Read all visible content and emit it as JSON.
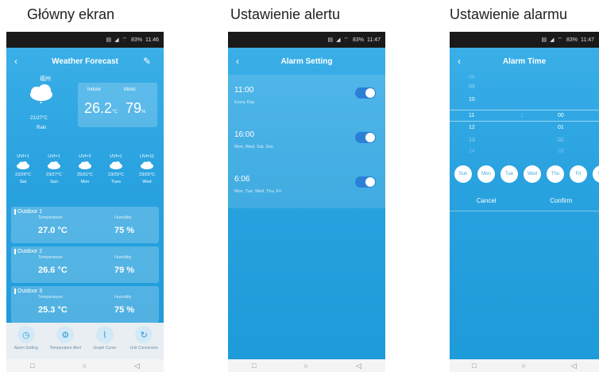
{
  "headings": {
    "main": "Główny ekran",
    "alert": "Ustawienie alertu",
    "alarm": "Ustawienie alarmu"
  },
  "status": {
    "p1": {
      "battery": "83%",
      "time": "11:46"
    },
    "p2": {
      "battery": "83%",
      "time": "11:47"
    },
    "p3": {
      "battery": "83%",
      "time": "11:47"
    }
  },
  "weather": {
    "title": "Weather Forecast",
    "city": "福州",
    "temp_range": "21/27°C",
    "description": "Rain",
    "indoor_label": "Indoor",
    "moist_label": "Moist",
    "indoor_temp": "26.2",
    "temp_unit": "°C",
    "indoor_humidity": "79",
    "hum_unit": "%",
    "forecast": [
      {
        "uvi": "UVI=1",
        "temp": "22/26°C",
        "day": "Sat",
        "icon": "rain-cloud-icon"
      },
      {
        "uvi": "UVI=1",
        "temp": "23/27°C",
        "day": "Sun",
        "icon": "cloud-icon"
      },
      {
        "uvi": "UVI=2",
        "temp": "25/31°C",
        "day": "Mon",
        "icon": "cloud-icon"
      },
      {
        "uvi": "UVI=1",
        "temp": "23/25°C",
        "day": "Tues",
        "icon": "rain-cloud-icon"
      },
      {
        "uvi": "UVI=11",
        "temp": "23/25°C",
        "day": "Wed",
        "icon": "cloud-icon"
      }
    ],
    "outdoor": [
      {
        "name": "Outdoor 1",
        "temp_label": "Temperature",
        "hum_label": "Humidity",
        "temp": "27.0 °C",
        "hum": "75 %"
      },
      {
        "name": "Outdoor 2",
        "temp_label": "Temperature",
        "hum_label": "Humidity",
        "temp": "26.6 °C",
        "hum": "79 %"
      },
      {
        "name": "Outdoor 3",
        "temp_label": "Temperature",
        "hum_label": "Humidity",
        "temp": "25.3 °C",
        "hum": "75 %"
      }
    ],
    "menu": [
      {
        "label": "Alarm Setting",
        "icon": "clock-icon"
      },
      {
        "label": "Temperature Alert",
        "icon": "gear-icon"
      },
      {
        "label": "Graph Curve",
        "icon": "graph-icon"
      },
      {
        "label": "Unit Conversion",
        "icon": "refresh-icon"
      }
    ]
  },
  "alarm_setting": {
    "title": "Alarm Setting",
    "alarms": [
      {
        "time": "11:00",
        "days": "Every Day",
        "on": true
      },
      {
        "time": "16:00",
        "days": "Mon, Wed, Sat, Sun",
        "on": true
      },
      {
        "time": "6:06",
        "days": "Mon, Tue, Wed, Thu, Fri",
        "on": true
      }
    ]
  },
  "alarm_time": {
    "title": "Alarm Time",
    "hours": [
      "08",
      "09",
      "10",
      "11",
      "12",
      "13",
      "14"
    ],
    "minutes": [
      "",
      "",
      "",
      "00",
      "01",
      "02",
      "03"
    ],
    "separator": ":",
    "days": [
      "Sun",
      "Mon",
      "Tue",
      "Wed",
      "Thu",
      "Fri",
      "Sat"
    ],
    "cancel": "Cancel",
    "confirm": "Confirm"
  },
  "nav": {
    "square": "□",
    "circle": "○",
    "back": "◁"
  }
}
